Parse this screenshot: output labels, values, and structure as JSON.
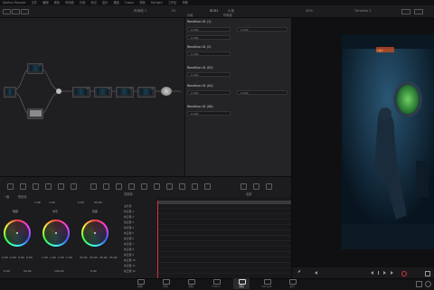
{
  "menubar": {
    "items": [
      "DaVinci Resolve",
      "文件",
      "编辑",
      "修剪",
      "时间线",
      "片段",
      "标记",
      "显示",
      "播放",
      "Fusion",
      "调色",
      "Fairlight",
      "工作区",
      "帮助"
    ]
  },
  "toolbar": {
    "timeline_label": "时间线 1",
    "clip_label": "01",
    "center_label": "SC01",
    "clip_info": "片段",
    "right_label": "Timeline 1",
    "zoom": "32%"
  },
  "keyframe_panel": {
    "header": "片段",
    "sub": "时间线",
    "groups": [
      {
        "title": "Rendition 01 (1)",
        "fields": [
          "0.000",
          "0.000",
          "0.000",
          "0.000"
        ]
      },
      {
        "title": "Rendition 01 (2)",
        "fields": [
          "0.000",
          "0.000"
        ]
      },
      {
        "title": "Rendition 01 (03)",
        "fields": [
          "0.000",
          "0.000"
        ]
      },
      {
        "title": "Rendition 01 (04)",
        "fields": [
          "0.000",
          "0.000",
          "0.000",
          "0.000"
        ]
      },
      {
        "title": "Rendition 01 (1) (05)",
        "fields": [
          "0.000",
          "0.000",
          "0.000",
          "0.000"
        ]
      },
      {
        "title": "Rendition 01 (06)",
        "fields": [
          "0.000",
          "0.000"
        ]
      }
    ]
  },
  "viewer": {
    "title": "Timeline 1",
    "scene_text": "卡通片"
  },
  "wheels_panel": {
    "tabs": [
      "一级",
      "校色轮"
    ],
    "wheels": [
      {
        "label": "暗部",
        "values": [
          "0.00",
          "0.00",
          "0.00",
          "0.00"
        ],
        "bottom": [
          "0.00",
          "0.00"
        ]
      },
      {
        "label": "中灰",
        "values": [
          "1.00",
          "1.00",
          "1.00",
          "1.00"
        ],
        "bottom": [
          "0.00",
          "0.00"
        ]
      },
      {
        "label": "亮部",
        "values": [
          "25.00",
          "25.00",
          "25.00",
          "25.00"
        ],
        "bottom": [
          "0.00",
          "0.00"
        ]
      }
    ],
    "top_values": [
      "1.00",
      "1.00",
      "0.00",
      "50.00"
    ],
    "bottom_values": [
      "0.00",
      "50.00",
      "100.00",
      "0.00"
    ]
  },
  "keyframes": {
    "header": "关键帧",
    "mode": "全部",
    "items": [
      "主片段",
      "校正器 1",
      "校正器 2",
      "校正器 3",
      "校正器 4",
      "校正器 5",
      "校正器 6",
      "校正器 7",
      "校正器 8",
      "校正器 9",
      "校正器 10",
      "校正器 11",
      "校正器 12"
    ]
  },
  "pages": [
    {
      "label": "媒体"
    },
    {
      "label": "剪切"
    },
    {
      "label": "剪辑"
    },
    {
      "label": "Fusion"
    },
    {
      "label": "调色"
    },
    {
      "label": "Fairlight"
    },
    {
      "label": "交付"
    }
  ],
  "colors": {
    "accent_red": "#d9323a",
    "node_bg": "#2a2a2d",
    "panel_bg": "#1f1f22"
  }
}
